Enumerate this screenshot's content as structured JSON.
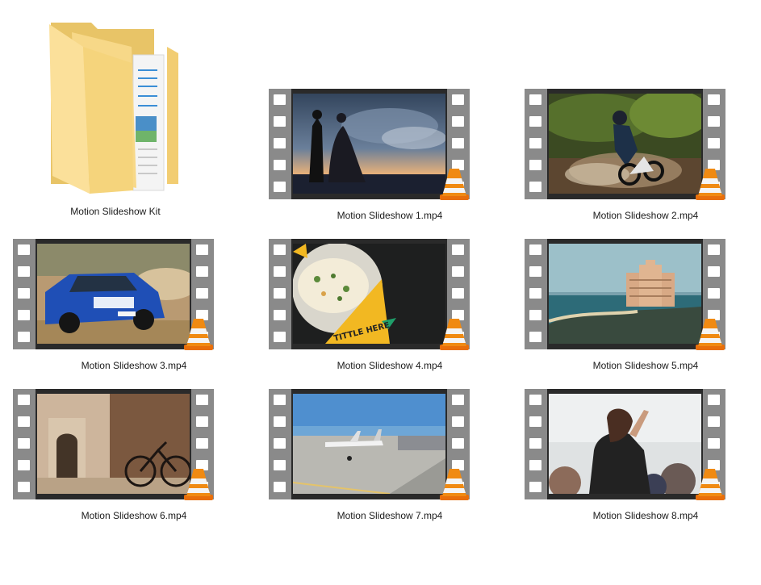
{
  "items": [
    {
      "label": "Motion Slideshow Kit",
      "type": "folder"
    },
    {
      "label": "Motion Slideshow 1.mp4",
      "type": "video",
      "thumb": "wedding-couple"
    },
    {
      "label": "Motion Slideshow 2.mp4",
      "type": "video",
      "thumb": "motocross-rider"
    },
    {
      "label": "Motion Slideshow 3.mp4",
      "type": "video",
      "thumb": "rally-car"
    },
    {
      "label": "Motion Slideshow 4.mp4",
      "type": "video",
      "thumb": "soup-bowl",
      "overlay_text": "TITTLE HERE"
    },
    {
      "label": "Motion Slideshow 5.mp4",
      "type": "video",
      "thumb": "beach-hotel"
    },
    {
      "label": "Motion Slideshow 6.mp4",
      "type": "video",
      "thumb": "old-bicycle"
    },
    {
      "label": "Motion Slideshow 7.mp4",
      "type": "video",
      "thumb": "airport-plane"
    },
    {
      "label": "Motion Slideshow 8.mp4",
      "type": "video",
      "thumb": "concert-girl"
    }
  ]
}
